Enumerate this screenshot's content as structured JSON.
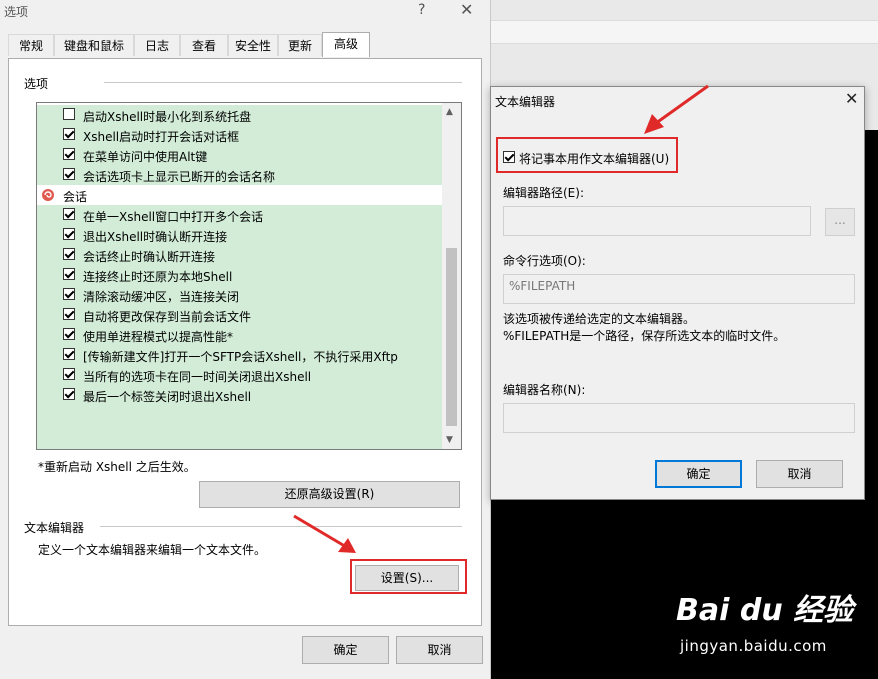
{
  "main_dialog": {
    "title": "选项",
    "help_glyph": "?",
    "close_glyph": "✕",
    "tabs": [
      {
        "label": "常规",
        "active": false
      },
      {
        "label": "键盘和鼠标",
        "active": false
      },
      {
        "label": "日志",
        "active": false
      },
      {
        "label": "查看",
        "active": false
      },
      {
        "label": "安全性",
        "active": false
      },
      {
        "label": "更新",
        "active": false
      },
      {
        "label": "高级",
        "active": true
      }
    ],
    "options_group_label": "选项",
    "options_list": [
      {
        "text": "启动Xshell时最小化到系统托盘",
        "checked": false
      },
      {
        "text": "Xshell启动时打开会话对话框",
        "checked": true
      },
      {
        "text": "在菜单访问中使用Alt键",
        "checked": true
      },
      {
        "text": "会话选项卡上显示已断开的会话名称",
        "checked": true
      }
    ],
    "session_category": "会话",
    "session_options": [
      {
        "text": "在单一Xshell窗口中打开多个会话",
        "checked": true
      },
      {
        "text": "退出Xshell时确认断开连接",
        "checked": true
      },
      {
        "text": "会话终止时确认断开连接",
        "checked": true
      },
      {
        "text": "连接终止时还原为本地Shell",
        "checked": true
      },
      {
        "text": "清除滚动缓冲区，当连接关闭",
        "checked": true
      },
      {
        "text": "自动将更改保存到当前会话文件",
        "checked": true
      },
      {
        "text": "使用单进程模式以提高性能*",
        "checked": true
      },
      {
        "text": "[传输新建文件]打开一个SFTP会话Xshell，不执行采用Xftp",
        "checked": true
      },
      {
        "text": "当所有的选项卡在同一时间关闭退出Xshell",
        "checked": true
      },
      {
        "text": "最后一个标签关闭时退出Xshell",
        "checked": true
      }
    ],
    "restart_note": "*重新启动 Xshell 之后生效。",
    "restore_button": "还原高级设置(R)",
    "editor_group_label": "文本编辑器",
    "editor_desc": "定义一个文本编辑器来编辑一个文本文件。",
    "settings_button": "设置(S)...",
    "ok_button": "确定",
    "cancel_button": "取消"
  },
  "editor_dialog": {
    "title": "文本编辑器",
    "close_glyph": "✕",
    "use_notepad_label": "将记事本用作文本编辑器(U)",
    "use_notepad_checked": true,
    "path_label": "编辑器路径(E):",
    "path_value": "",
    "browse_button": "...",
    "cmd_label": "命令行选项(O):",
    "cmd_value": "%FILEPATH",
    "cmd_desc_line1": "该选项被传递给选定的文本编辑器。",
    "cmd_desc_line2": "%FILEPATH是一个路径，保存所选文本的临时文件。",
    "name_label": "编辑器名称(N):",
    "name_value": "",
    "ok_button": "确定",
    "cancel_button": "取消"
  },
  "watermark": {
    "logo": "Bai du 经验",
    "url": "jingyan.baidu.com"
  },
  "colors": {
    "highlight_green": "#d2ecd8",
    "annotation_red": "#e02a2a",
    "focus_blue": "#0078d7"
  }
}
